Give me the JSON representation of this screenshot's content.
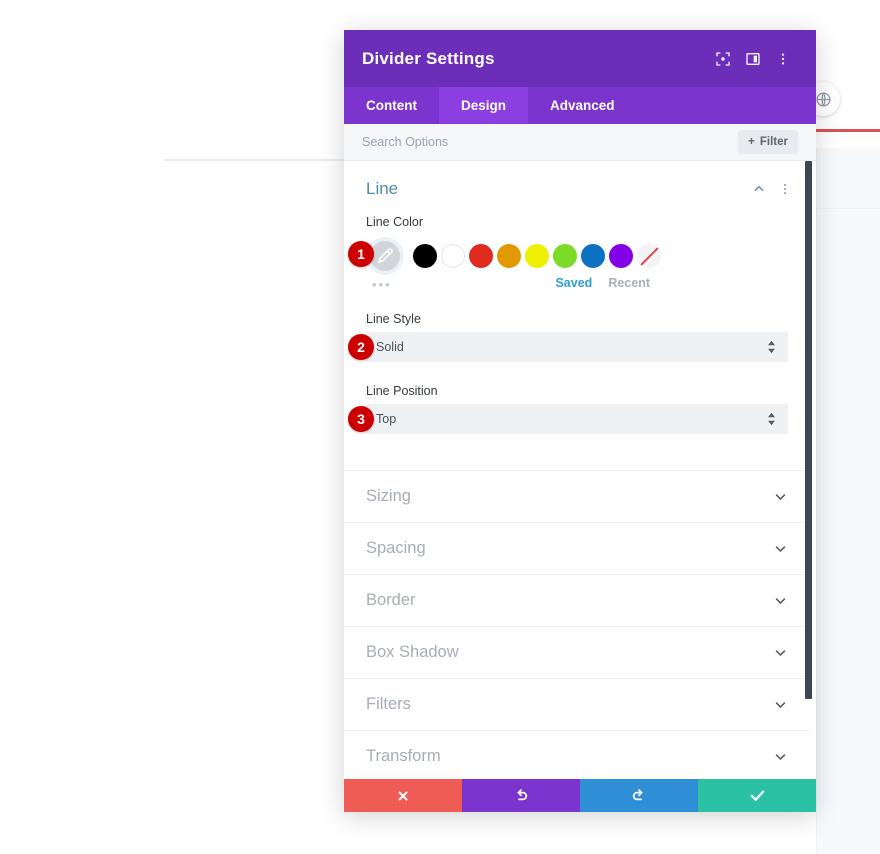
{
  "background": {
    "round_button_icon": "globe-icon",
    "divider_faint_color": "#e9edf2",
    "divider_red_color": "#d9534f"
  },
  "modal": {
    "title": "Divider Settings",
    "header_icons": [
      {
        "name": "focus-icon",
        "glyph": "⧉"
      },
      {
        "name": "layout-icon",
        "glyph": "▣"
      },
      {
        "name": "more-vertical-icon",
        "glyph": "⋮"
      }
    ],
    "tabs": [
      {
        "label": "Content",
        "active": false
      },
      {
        "label": "Design",
        "active": true
      },
      {
        "label": "Advanced",
        "active": false
      }
    ],
    "search": {
      "placeholder": "Search Options",
      "value": "",
      "filter_label": "Filter",
      "filter_icon": "plus-icon"
    },
    "line_section": {
      "title": "Line",
      "collapse_icon": "chevron-up-icon",
      "menu_icon": "more-vertical-icon",
      "color_field": {
        "label": "Line Color",
        "picker_icon": "eyedropper-icon",
        "more_dots": "•••",
        "saved_label": "Saved",
        "recent_label": "Recent",
        "swatches": [
          {
            "name": "black",
            "hex": "#000000"
          },
          {
            "name": "white",
            "hex": "#ffffff"
          },
          {
            "name": "red",
            "hex": "#e02b20"
          },
          {
            "name": "orange",
            "hex": "#e09900"
          },
          {
            "name": "yellow",
            "hex": "#edf000"
          },
          {
            "name": "green",
            "hex": "#7cdb28"
          },
          {
            "name": "blue",
            "hex": "#0c71c3"
          },
          {
            "name": "purple",
            "hex": "#8300e9"
          }
        ],
        "clear_swatch": "transparent"
      },
      "style_field": {
        "label": "Line Style",
        "value": "Solid"
      },
      "position_field": {
        "label": "Line Position",
        "value": "Top"
      }
    },
    "badges": [
      {
        "number": "1"
      },
      {
        "number": "2"
      },
      {
        "number": "3"
      }
    ],
    "closed_sections": [
      {
        "label": "Sizing"
      },
      {
        "label": "Spacing"
      },
      {
        "label": "Border"
      },
      {
        "label": "Box Shadow"
      },
      {
        "label": "Filters"
      },
      {
        "label": "Transform"
      }
    ],
    "footer": {
      "cancel": {
        "icon": "close-icon",
        "color": "#ef5c55"
      },
      "undo": {
        "icon": "undo-icon",
        "color": "#7b34cd"
      },
      "redo": {
        "icon": "redo-icon",
        "color": "#2e8ed6"
      },
      "save": {
        "icon": "checkmark-icon",
        "color": "#2bc2a4"
      }
    }
  }
}
